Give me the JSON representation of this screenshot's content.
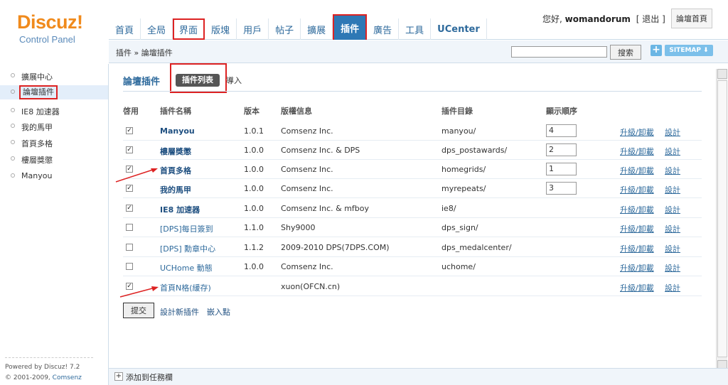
{
  "logo": {
    "brand": "Discuz!",
    "subtitle": "Control Panel"
  },
  "nav": {
    "tabs": [
      {
        "label": "首頁"
      },
      {
        "label": "全局"
      },
      {
        "label": "界面"
      },
      {
        "label": "版塊"
      },
      {
        "label": "用戶"
      },
      {
        "label": "帖子"
      },
      {
        "label": "擴展"
      },
      {
        "label": "插件"
      },
      {
        "label": "廣告"
      },
      {
        "label": "工具"
      },
      {
        "label": "UCenter"
      }
    ]
  },
  "user": {
    "greeting": "您好,",
    "name": "womandorum",
    "logout": "[ 退出 ]",
    "home": "論壇首頁"
  },
  "breadcrumb": "插件 » 論壇插件",
  "search": {
    "button": "搜索",
    "value": ""
  },
  "toolbar": {
    "plus": "+",
    "sitemap": "SITEMAP ⬇"
  },
  "sidebar": {
    "items": [
      {
        "label": "擴展中心"
      },
      {
        "label": "論壇插件"
      },
      {
        "label": "IE8 加速器"
      },
      {
        "label": "我的馬甲"
      },
      {
        "label": "首頁多格"
      },
      {
        "label": "樓層獎懲"
      },
      {
        "label": "Manyou"
      }
    ],
    "powered_line1": "Powered by Discuz! 7.2",
    "powered_line2_prefix": "© 2001-2009,",
    "powered_line2_link": "Comsenz Inc."
  },
  "main": {
    "title": "論壇插件",
    "tab_list": "插件列表",
    "tab_import": "導入",
    "headers": {
      "enable": "啓用",
      "name": "插件名稱",
      "version": "版本",
      "copyright": "版權信息",
      "directory": "插件目錄",
      "order": "顯示順序"
    },
    "plugins": [
      {
        "checked": "✓",
        "name": "Manyou",
        "version": "1.0.1",
        "copyright": "Comsenz Inc.",
        "directory": "manyou/",
        "order": "4",
        "action1": "升級/卸載",
        "action2": "設計"
      },
      {
        "checked": "✓",
        "name": "樓層獎懲",
        "version": "1.0.0",
        "copyright": "Comsenz Inc. & DPS",
        "directory": "dps_postawards/",
        "order": "2",
        "action1": "升級/卸載",
        "action2": "設計"
      },
      {
        "checked": "✓",
        "name": "首頁多格",
        "version": "1.0.0",
        "copyright": "Comsenz Inc.",
        "directory": "homegrids/",
        "order": "1",
        "action1": "升級/卸載",
        "action2": "設計"
      },
      {
        "checked": "✓",
        "name": "我的馬甲",
        "version": "1.0.0",
        "copyright": "Comsenz Inc.",
        "directory": "myrepeats/",
        "order": "3",
        "action1": "升級/卸載",
        "action2": "設計"
      },
      {
        "checked": "✓",
        "name": "IE8 加速器",
        "version": "1.0.0",
        "copyright": "Comsenz Inc. & mfboy",
        "directory": "ie8/",
        "order": "",
        "action1": "升級/卸載",
        "action2": "設計"
      },
      {
        "checked": "",
        "name": "[DPS]每日簽到",
        "version": "1.1.0",
        "copyright": "Shy9000",
        "directory": "dps_sign/",
        "order": "",
        "action1": "升級/卸載",
        "action2": "設計"
      },
      {
        "checked": "",
        "name": "[DPS] 勳章中心",
        "version": "1.1.2",
        "copyright": "2009-2010 DPS(7DPS.COM)",
        "directory": "dps_medalcenter/",
        "order": "",
        "action1": "升級/卸載",
        "action2": "設計"
      },
      {
        "checked": "",
        "name": "UCHome 動態",
        "version": "1.0.0",
        "copyright": "Comsenz Inc.",
        "directory": "uchome/",
        "order": "",
        "action1": "升級/卸載",
        "action2": "設計"
      },
      {
        "checked": "✓",
        "name": "首頁N格(緩存)",
        "version": "",
        "copyright": "xuon(OFCN.cn)",
        "directory": "",
        "order": "",
        "action1": "升級/卸載",
        "action2": "設計"
      }
    ],
    "submit": "提交",
    "design_new": "設計新插件",
    "embed": "嵌入點"
  },
  "taskbar": {
    "plus": "+",
    "label": "添加到任務欄"
  },
  "colors": {
    "accent": "#2e6a9c",
    "nav_active": "#2e78b5",
    "highlight": "#dd2222",
    "brand": "#f08a1c"
  }
}
